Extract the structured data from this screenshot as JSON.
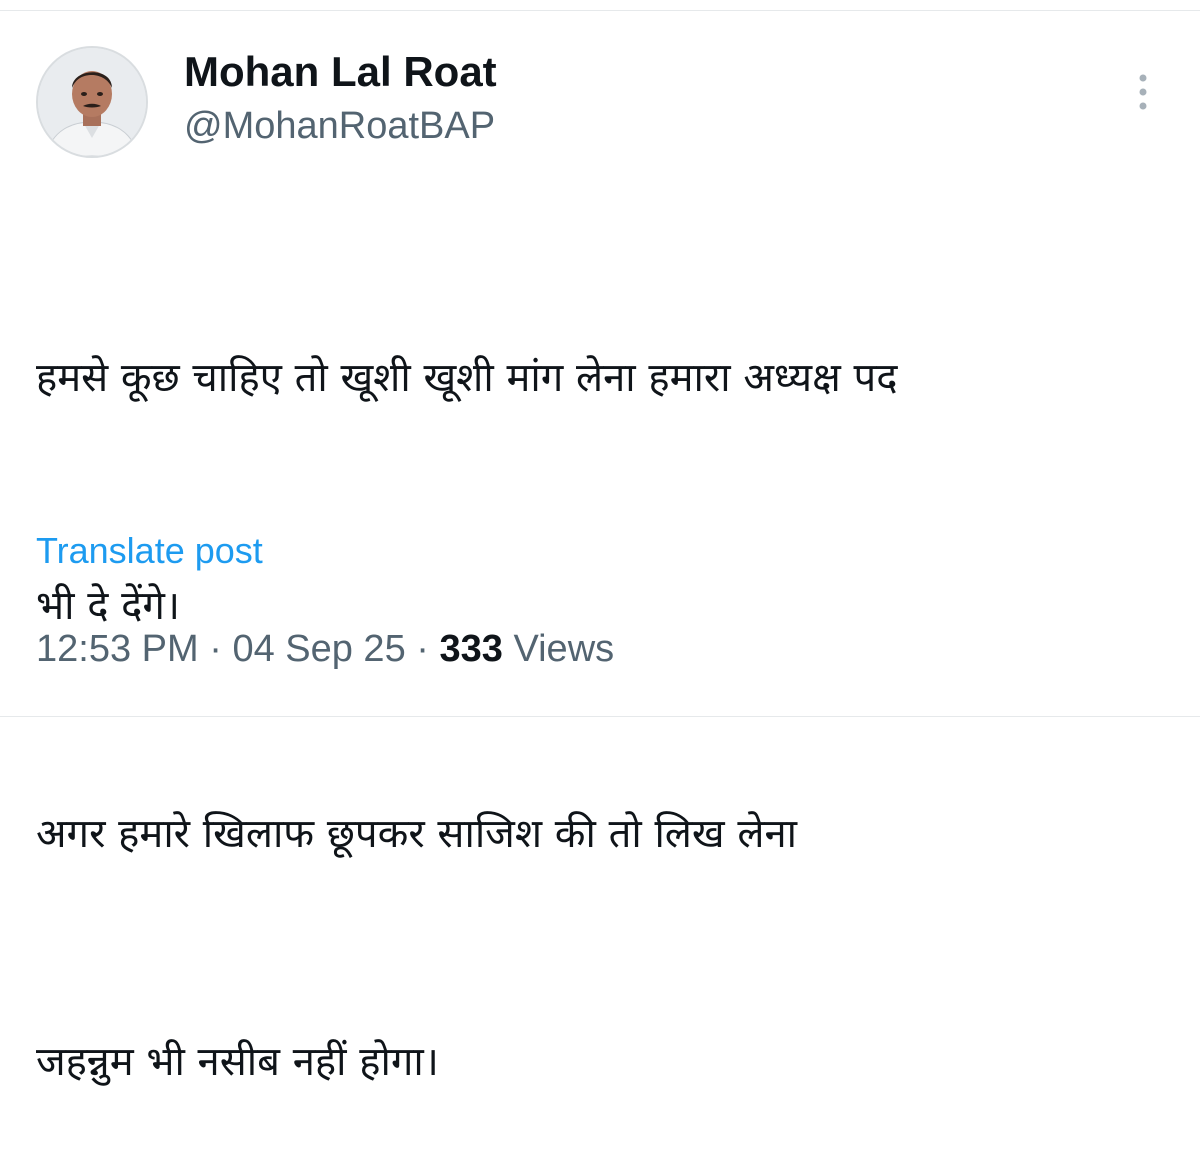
{
  "author": {
    "display_name": "Mohan Lal Roat",
    "handle": "@MohanRoatBAP"
  },
  "post": {
    "text_line_1": "हमसे कूछ चाहिए तो खूशी खूशी मांग लेना हमारा अध्यक्ष पद",
    "text_line_2": "भी दे देंगे।",
    "text_line_3": "अगर हमारे खिलाफ छूपकर साजिश की तो लिख लेना",
    "text_line_4": "जहन्नुम भी नसीब नहीं होगा।",
    "translate_label": "Translate post"
  },
  "meta": {
    "time": "12:53 PM",
    "separator": " · ",
    "date": "04 Sep 25",
    "views_count": "333",
    "views_label": "Views"
  },
  "icons": {
    "more": "more-vertical-icon",
    "avatar": "profile-photo"
  },
  "colors": {
    "link": "#1d9bf0",
    "secondary_text": "#536471",
    "primary_text": "#0f1419",
    "divider": "#e6e9eb"
  }
}
